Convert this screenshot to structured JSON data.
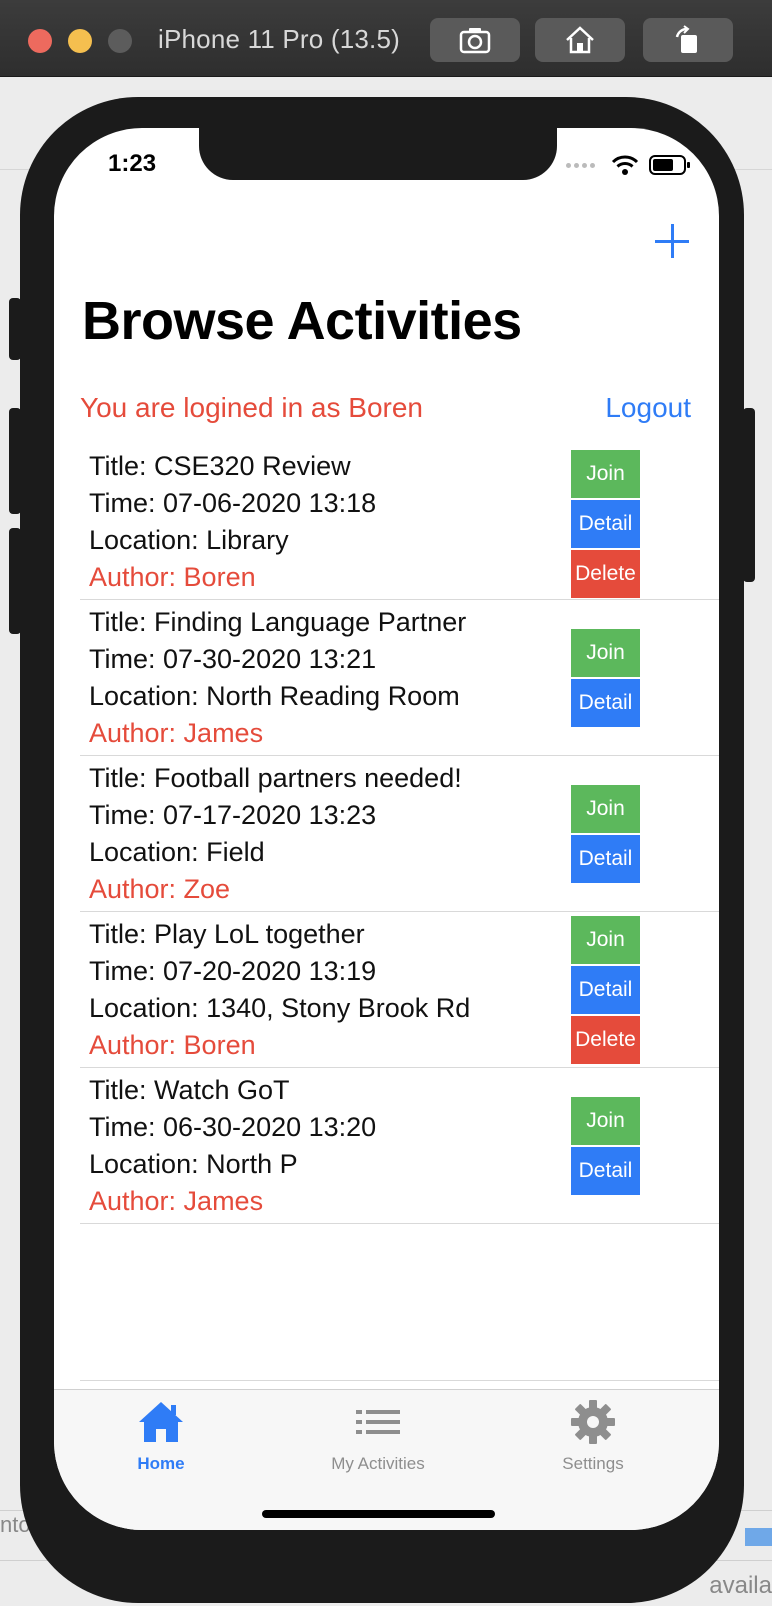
{
  "simulator": {
    "title": "iPhone 11 Pro (13.5)"
  },
  "desktop": {
    "bottom_left_fragment": "nto",
    "bottom_right_fragment": "availa"
  },
  "status_bar": {
    "time": "1:23"
  },
  "header": {
    "add_icon": "plus-icon",
    "title": "Browse Activities"
  },
  "session": {
    "logged_in_text": "You are logined in as Boren",
    "logout_label": "Logout"
  },
  "activities": [
    {
      "title": "Title: CSE320 Review",
      "time": "Time: 07-06-2020 13:18",
      "location": "Location: Library",
      "author": "Author: Boren",
      "join_label": "Join",
      "detail_label": "Detail",
      "delete_label": "Delete"
    },
    {
      "title": "Title: Finding Language Partner",
      "time": "Time: 07-30-2020 13:21",
      "location": "Location: North Reading Room",
      "author": "Author: James",
      "join_label": "Join",
      "detail_label": "Detail"
    },
    {
      "title": "Title: Football partners needed!",
      "time": "Time: 07-17-2020 13:23",
      "location": "Location: Field",
      "author": "Author: Zoe",
      "join_label": "Join",
      "detail_label": "Detail"
    },
    {
      "title": "Title: Play LoL together",
      "time": "Time: 07-20-2020 13:19",
      "location": "Location: 1340, Stony Brook Rd",
      "author": "Author: Boren",
      "join_label": "Join",
      "detail_label": "Detail",
      "delete_label": "Delete"
    },
    {
      "title": "Title: Watch GoT",
      "time": "Time: 06-30-2020 13:20",
      "location": "Location: North P",
      "author": "Author: James",
      "join_label": "Join",
      "detail_label": "Detail"
    }
  ],
  "tabbar": {
    "tabs": [
      {
        "label": "Home",
        "icon": "home-icon",
        "active": true
      },
      {
        "label": "My Activities",
        "icon": "list-icon",
        "active": false
      },
      {
        "label": "Settings",
        "icon": "gear-icon",
        "active": false
      }
    ]
  },
  "colors": {
    "accent": "#2f7cf6",
    "danger": "#e54b3b",
    "success": "#5cb85c"
  }
}
